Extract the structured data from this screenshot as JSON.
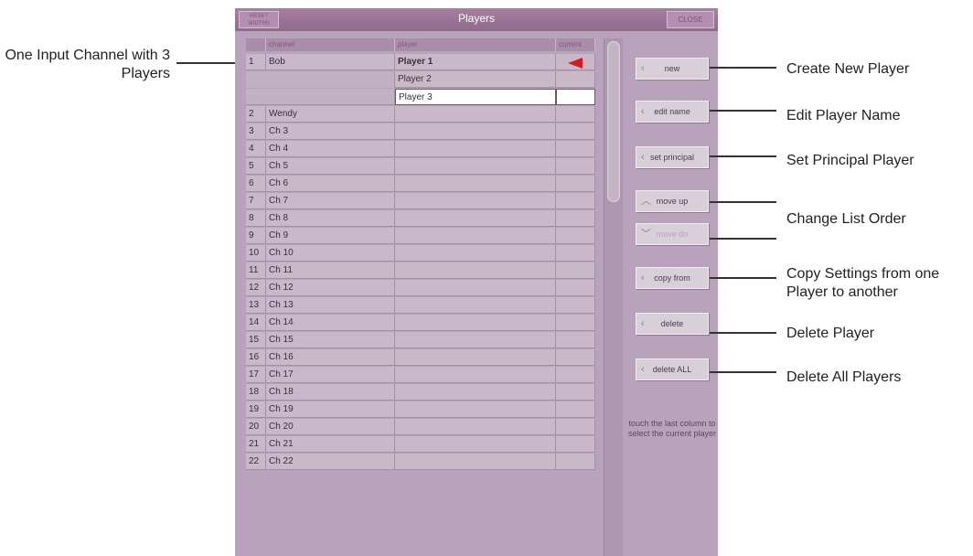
{
  "window": {
    "title": "Players",
    "reset_label": "RESET WIDTHS",
    "close_label": "CLOSE"
  },
  "table": {
    "headers": [
      "",
      "channel",
      "player",
      "current"
    ],
    "rows": [
      {
        "num": "1",
        "channel": "Bob",
        "player": "Player 1",
        "current": "arrow"
      },
      {
        "num": "",
        "channel": "",
        "player": "Player 2",
        "current": ""
      },
      {
        "num": "",
        "channel": "",
        "player": "Player 3",
        "current": ""
      },
      {
        "num": "2",
        "channel": "Wendy",
        "player": "",
        "current": ""
      },
      {
        "num": "3",
        "channel": "Ch 3",
        "player": "",
        "current": ""
      },
      {
        "num": "4",
        "channel": "Ch 4",
        "player": "",
        "current": ""
      },
      {
        "num": "5",
        "channel": "Ch 5",
        "player": "",
        "current": ""
      },
      {
        "num": "6",
        "channel": "Ch 6",
        "player": "",
        "current": ""
      },
      {
        "num": "7",
        "channel": "Ch 7",
        "player": "",
        "current": ""
      },
      {
        "num": "8",
        "channel": "Ch 8",
        "player": "",
        "current": ""
      },
      {
        "num": "9",
        "channel": "Ch 9",
        "player": "",
        "current": ""
      },
      {
        "num": "10",
        "channel": "Ch 10",
        "player": "",
        "current": ""
      },
      {
        "num": "11",
        "channel": "Ch 11",
        "player": "",
        "current": ""
      },
      {
        "num": "12",
        "channel": "Ch 12",
        "player": "",
        "current": ""
      },
      {
        "num": "13",
        "channel": "Ch 13",
        "player": "",
        "current": ""
      },
      {
        "num": "14",
        "channel": "Ch 14",
        "player": "",
        "current": ""
      },
      {
        "num": "15",
        "channel": "Ch 15",
        "player": "",
        "current": ""
      },
      {
        "num": "16",
        "channel": "Ch 16",
        "player": "",
        "current": ""
      },
      {
        "num": "17",
        "channel": "Ch 17",
        "player": "",
        "current": ""
      },
      {
        "num": "18",
        "channel": "Ch 18",
        "player": "",
        "current": ""
      },
      {
        "num": "19",
        "channel": "Ch 19",
        "player": "",
        "current": ""
      },
      {
        "num": "20",
        "channel": "Ch 20",
        "player": "",
        "current": ""
      },
      {
        "num": "21",
        "channel": "Ch 21",
        "player": "",
        "current": ""
      },
      {
        "num": "22",
        "channel": "Ch 22",
        "player": "",
        "current": ""
      }
    ]
  },
  "buttons": {
    "new": "new",
    "edit_name": "edit name",
    "set_principal": "set principal",
    "move_up": "move up",
    "move_dn": "move dn",
    "copy_from": "copy from",
    "delete": "delete",
    "delete_all": "delete ALL"
  },
  "hint": "touch the last column to select the current player",
  "annotations": {
    "input_channel": "One Input Channel with 3 Players",
    "create": "Create New Player",
    "edit": "Edit Player Name",
    "principal": "Set Principal Player",
    "order": "Change List Order",
    "copy": "Copy Settings from one Player to another",
    "delete": "Delete Player",
    "delete_all": "Delete All Players"
  },
  "colors": {
    "panel": "#b9a3bc",
    "titlebar": "#8f6a8b",
    "current_arrow": "#d11d1d"
  }
}
